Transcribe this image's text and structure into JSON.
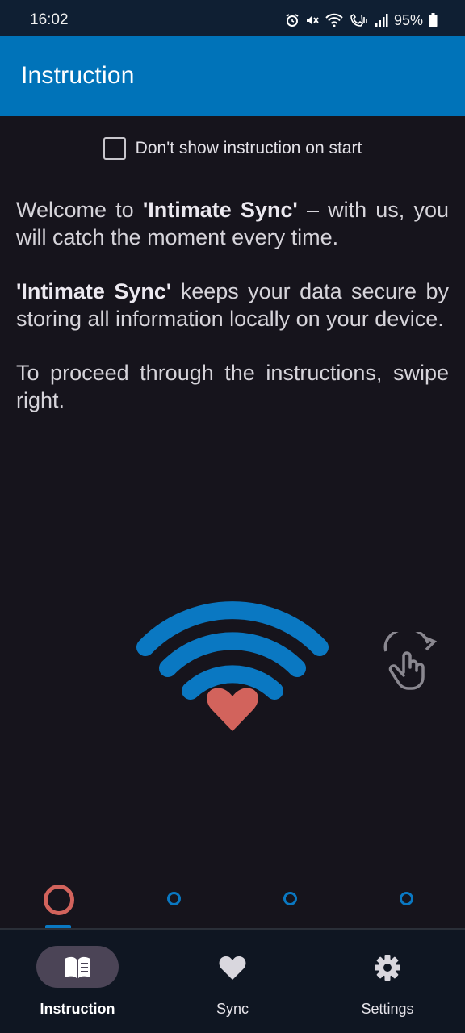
{
  "status_bar": {
    "time": "16:02",
    "battery": "95%",
    "icons": [
      "alarm-icon",
      "mute-icon",
      "wifi-icon",
      "wifi-calling-icon",
      "signal-icon",
      "signal-icon-2",
      "battery-icon"
    ]
  },
  "app_bar": {
    "title": "Instruction",
    "color": "#0073b9"
  },
  "checkbox": {
    "label": "Don't show instruction on start",
    "checked": false
  },
  "welcome": {
    "p1_pre": "Welcome to ",
    "p1_bold": "'Intimate Sync'",
    "p1_post": " – with us, you will catch the moment every time.",
    "p2_bold": "'Intimate Sync'",
    "p2_post": " keeps your data secure by storing all information locally on your device.",
    "p3": "To proceed through the instructions, swipe right."
  },
  "illustration": {
    "logo_icon": "wifi-heart-logo-icon",
    "swipe_icon": "swipe-hand-icon",
    "wave_color": "#0a78c2",
    "heart_color": "#d2635c"
  },
  "pager": {
    "current": 1,
    "total": 4
  },
  "bottom_nav": {
    "items": [
      {
        "label": "Instruction",
        "icon": "book-icon",
        "active": true
      },
      {
        "label": "Sync",
        "icon": "heart-icon",
        "active": false
      },
      {
        "label": "Settings",
        "icon": "gear-icon",
        "active": false
      }
    ]
  }
}
